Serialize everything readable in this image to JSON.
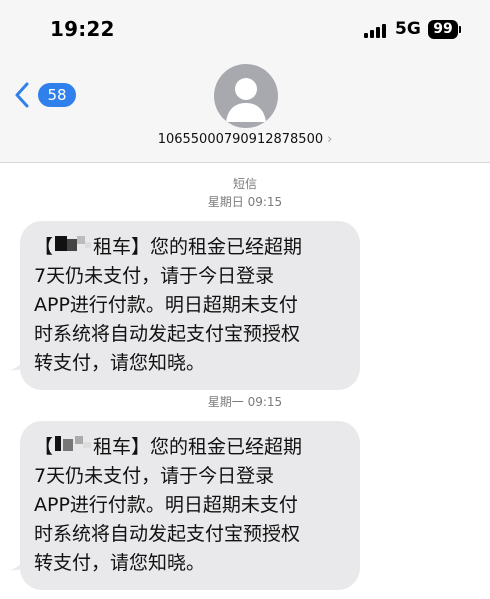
{
  "status_bar": {
    "time": "19:22",
    "network": "5G",
    "battery": "99"
  },
  "header": {
    "back_count": "58",
    "contact": "10655000790912878500",
    "contact_chevron": "›"
  },
  "thread": {
    "service_label": "短信",
    "messages": [
      {
        "timestamp": "星期日 09:15",
        "first_line_suffix": "租车】您的租金已经超期",
        "lines": [
          "7天仍未支付，请于今日登录",
          "APP进行付款。明日超期未支付",
          "时系统将自动发起支付宝预授权",
          "转支付，请您知晓。"
        ]
      },
      {
        "timestamp": "星期一 09:15",
        "first_line_suffix": "租车】您的租金已经超期",
        "lines": [
          "7天仍未支付，请于今日登录",
          "APP进行付款。明日超期未支付",
          "时系统将自动发起支付宝预授权",
          "转支付，请您知晓。"
        ]
      }
    ]
  },
  "colors": {
    "bubble": "#e9e9eb",
    "accent": "#2f80ed",
    "background": "#ffffff",
    "header": "#f6f6f6"
  },
  "icons": {
    "back": "chevron-left-icon",
    "avatar": "person-placeholder-icon",
    "signal": "cellular-signal-icon",
    "battery": "battery-icon"
  }
}
